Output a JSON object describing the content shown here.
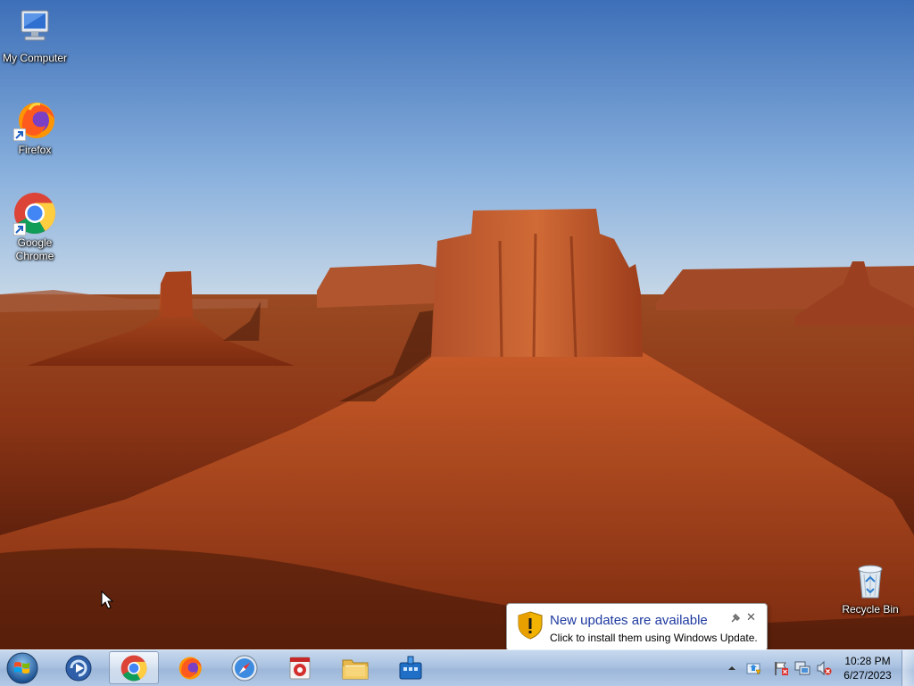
{
  "desktop": {
    "icons": [
      {
        "label": "My Computer",
        "icon": "computer-icon"
      },
      {
        "label": "Firefox",
        "icon": "firefox-icon"
      },
      {
        "label": "Google Chrome",
        "icon": "chrome-icon"
      },
      {
        "label": "Recycle Bin",
        "icon": "recycle-bin-icon"
      }
    ]
  },
  "notification": {
    "title": "New updates are available",
    "body": "Click to install them using Windows Update.",
    "icon": "warning-shield-icon",
    "title_color": "#1e3aa0"
  },
  "taskbar": {
    "start_icon": "windows-start-orb-icon",
    "pinned": [
      {
        "name": "media-center",
        "icon": "media-center-icon",
        "active": false
      },
      {
        "name": "chrome",
        "icon": "chrome-icon",
        "active": true
      },
      {
        "name": "firefox",
        "icon": "firefox-icon",
        "active": false
      },
      {
        "name": "safari",
        "icon": "safari-compass-icon",
        "active": false
      },
      {
        "name": "app-red",
        "icon": "red-app-icon",
        "active": false
      },
      {
        "name": "file-explorer",
        "icon": "folder-icon",
        "active": false
      },
      {
        "name": "network-app",
        "icon": "blue-network-icon",
        "active": false
      }
    ],
    "tray": {
      "icons": [
        "show-hidden-chevron-icon",
        "windows-update-icon",
        "action-center-flag-icon",
        "network-icon",
        "volume-muted-icon"
      ],
      "time": "10:28 PM",
      "date": "6/27/2023"
    }
  }
}
